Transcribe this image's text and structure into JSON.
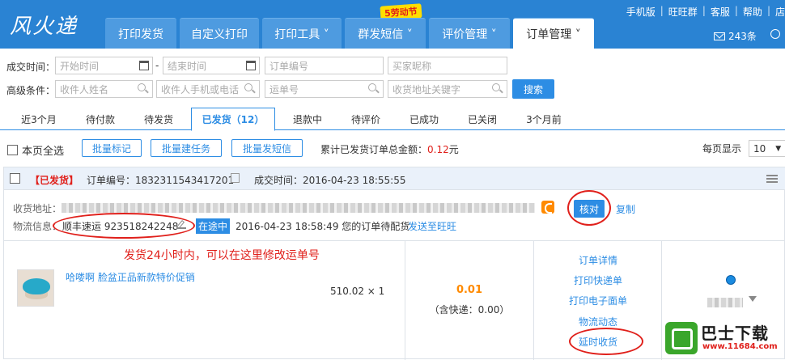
{
  "app": {
    "logo": "风火递",
    "promo": "5劳动节"
  },
  "nav": {
    "tabs": [
      {
        "label": "打印发货"
      },
      {
        "label": "自定义打印"
      },
      {
        "label": "打印工具 ˅"
      },
      {
        "label": "群发短信 ˅"
      },
      {
        "label": "评价管理 ˅"
      },
      {
        "label": "订单管理 ˅"
      }
    ],
    "active_tab": "订单管理"
  },
  "toplinks": [
    "手机版",
    "旺旺群",
    "客服",
    "帮助",
    "店"
  ],
  "mail": {
    "count": "243条"
  },
  "filters": {
    "deal_time_label": "成交时间：",
    "start_placeholder": "开始时间",
    "dash": "-",
    "end_placeholder": "结束时间",
    "order_no_placeholder": "订单编号",
    "buyer_placeholder": "买家昵称",
    "advanced_label": "高级条件：",
    "receiver_placeholder": "收件人姓名",
    "phone_placeholder": "收件人手机或电话",
    "waybill_placeholder": "运单号",
    "address_placeholder": "收货地址关键字",
    "search_button": "搜索"
  },
  "order_tabs": [
    {
      "label": "近3个月"
    },
    {
      "label": "待付款"
    },
    {
      "label": "待发货"
    },
    {
      "label": "已发货（12）"
    },
    {
      "label": "退款中"
    },
    {
      "label": "待评价"
    },
    {
      "label": "已成功"
    },
    {
      "label": "已关闭"
    },
    {
      "label": "3个月前"
    }
  ],
  "actions": {
    "select_all": "本页全选",
    "batch_mark": "批量标记",
    "batch_task": "批量建任务",
    "batch_sms": "批量发短信",
    "total_label": "累计已发货订单总金额：",
    "total_value": "0.12",
    "total_unit": "元",
    "page_size_label": "每页显示",
    "page_size": "10"
  },
  "order": {
    "status": "【已发货】",
    "order_no_label": "订单编号：",
    "order_no": "1832311543417201",
    "deal_time_label": "成交时间：",
    "deal_time": "2016-04-23 18:55:55",
    "address_label": "收货地址：",
    "verify_button": "核对",
    "copy_link": "复制",
    "logistics_label": "物流信息：",
    "logistics": "顺丰速运 923518242248",
    "transit_status": "在途中",
    "transit_time": "2016-04-23 18:58:49 您的订单待配货",
    "send_to_wangwang": "发送至旺旺",
    "annotation": "发货24小时内，可以在这里修改运单号",
    "item_title": "哈喽啊 脸盆正品新款特价促销",
    "item_price_qty": "510.02 × 1",
    "amount": "0.01",
    "shipping": "（含快递：0.00）",
    "operations": [
      "订单详情",
      "打印快递单",
      "打印电子面单",
      "物流动态",
      "延时收货"
    ]
  },
  "watermark": {
    "text": "巴士下载",
    "url": "www.11684.com"
  },
  "colors": {
    "header": "#2a83d3",
    "accent": "#2d8de4",
    "red": "#e0201b",
    "orange": "#ff8a00"
  }
}
